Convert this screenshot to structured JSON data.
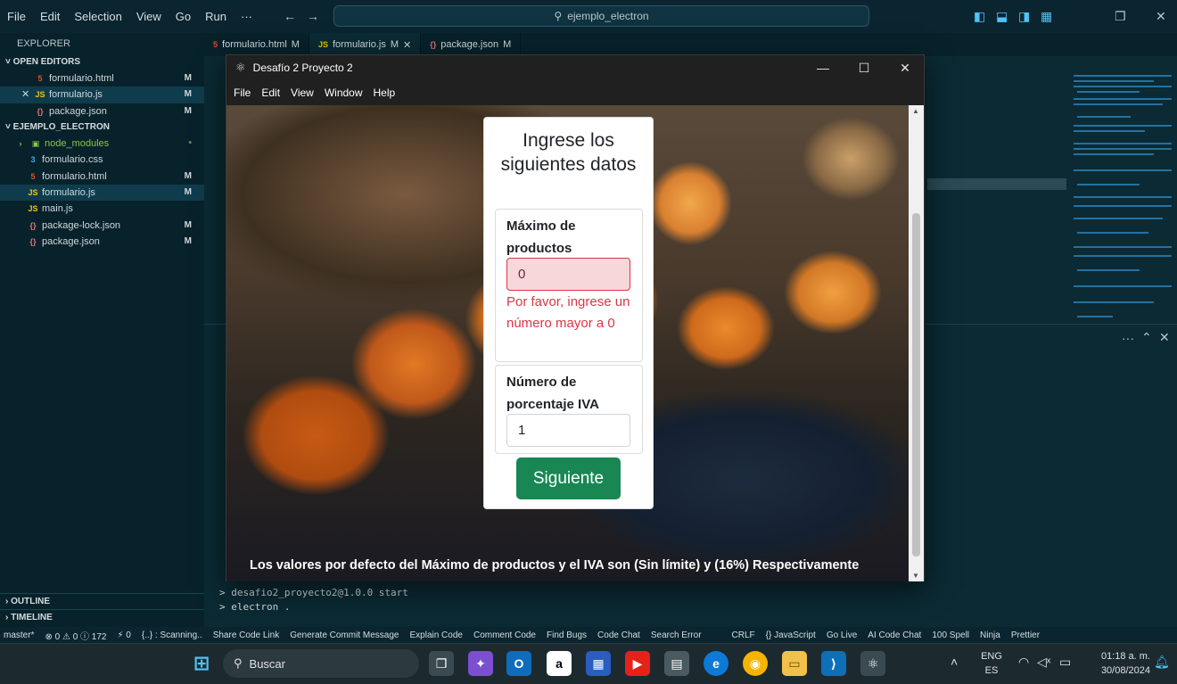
{
  "vscode": {
    "menu": [
      "File",
      "Edit",
      "Selection",
      "View",
      "Go",
      "Run",
      "···"
    ],
    "search": "ejemplo_electron",
    "explorer_title": "EXPLORER",
    "open_editors_title": "OPEN EDITORS",
    "open_editors": [
      {
        "name": "formulario.html",
        "icon": "html",
        "mod": "M"
      },
      {
        "name": "formulario.js",
        "icon": "js",
        "mod": "M"
      },
      {
        "name": "package.json",
        "icon": "json",
        "mod": "M"
      }
    ],
    "project_title": "EJEMPLO_ELECTRON",
    "files": [
      {
        "name": "node_modules",
        "icon": "folder",
        "mod": "•"
      },
      {
        "name": "formulario.css",
        "icon": "css",
        "mod": ""
      },
      {
        "name": "formulario.html",
        "icon": "html",
        "mod": "M"
      },
      {
        "name": "formulario.js",
        "icon": "js",
        "mod": "M"
      },
      {
        "name": "main.js",
        "icon": "js",
        "mod": ""
      },
      {
        "name": "package-lock.json",
        "icon": "json",
        "mod": "M"
      },
      {
        "name": "package.json",
        "icon": "json",
        "mod": "M"
      }
    ],
    "outline": "OUTLINE",
    "timeline": "TIMELINE",
    "tabs": [
      {
        "name": "formulario.html",
        "mod": "M"
      },
      {
        "name": "formulario.js",
        "mod": "M"
      },
      {
        "name": "package.json",
        "mod": "M"
      }
    ],
    "terminal_lines": [
      "> desafio2_proyecto2@1.0.0 start",
      "> electron ."
    ],
    "statusbar": [
      "master*",
      "⊗ 0 ⚠ 0 ⓘ 172",
      "⚡ 0",
      "{..} : Scanning..",
      "Share Code Link",
      "Generate Commit Message",
      "Explain Code",
      "Comment Code",
      "Find Bugs",
      "Code Chat",
      "Search Error",
      "CRLF",
      "{} JavaScript",
      "Go Live",
      "AI Code Chat",
      "100 Spell",
      "Ninja",
      "Prettier"
    ]
  },
  "electron": {
    "title": "Desafío 2 Proyecto 2",
    "menu": [
      "File",
      "Edit",
      "View",
      "Window",
      "Help"
    ],
    "form": {
      "title": "Ingrese los siguientes datos",
      "max_label": "Máximo de productos",
      "max_value": "0",
      "max_error": "Por favor, ingrese un número mayor a 0",
      "iva_label": "Número de porcentaje IVA",
      "iva_value": "1",
      "next_button": "Siguiente"
    },
    "footer_note": "Los valores por defecto del Máximo de productos y el IVA son (Sin límite) y (16%) Respectivamente"
  },
  "taskbar": {
    "search": "Buscar",
    "lang_top": "ENG",
    "lang_bottom": "ES",
    "time": "01:18 a. m.",
    "date": "30/08/2024"
  },
  "colors": {
    "accent": "#198754",
    "error": "#dc3545",
    "error_bg": "#f8d7da"
  }
}
